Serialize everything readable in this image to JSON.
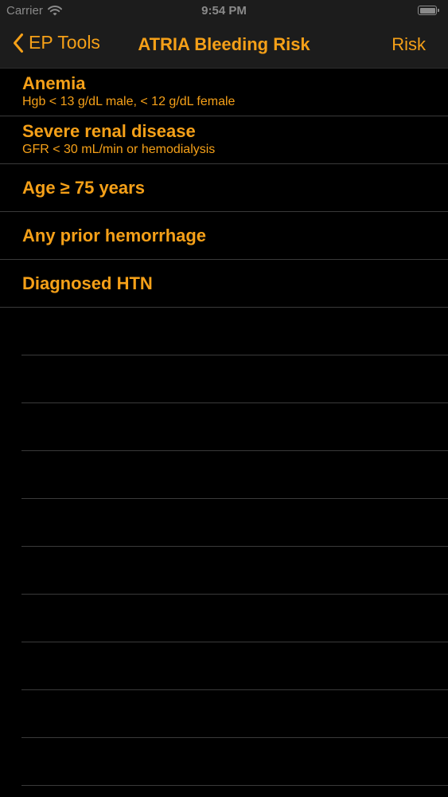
{
  "status_bar": {
    "carrier": "Carrier",
    "time": "9:54 PM"
  },
  "nav": {
    "back_label": "EP Tools",
    "title": "ATRIA Bleeding Risk",
    "right_label": "Risk"
  },
  "criteria": [
    {
      "title": "Anemia",
      "subtitle": "Hgb < 13 g/dL male, < 12 g/dL female"
    },
    {
      "title": "Severe renal disease",
      "subtitle": "GFR < 30 mL/min or hemodialysis"
    },
    {
      "title": "Age ≥ 75 years"
    },
    {
      "title": "Any prior hemorrhage"
    },
    {
      "title": "Diagnosed HTN"
    }
  ],
  "colors": {
    "accent": "#f5a018",
    "background": "#000000",
    "bar": "#1c1c1c",
    "separator": "#3a3a3a"
  },
  "icons": {
    "signal": "wifi-icon",
    "battery": "battery-icon",
    "back": "chevron-left-icon"
  }
}
